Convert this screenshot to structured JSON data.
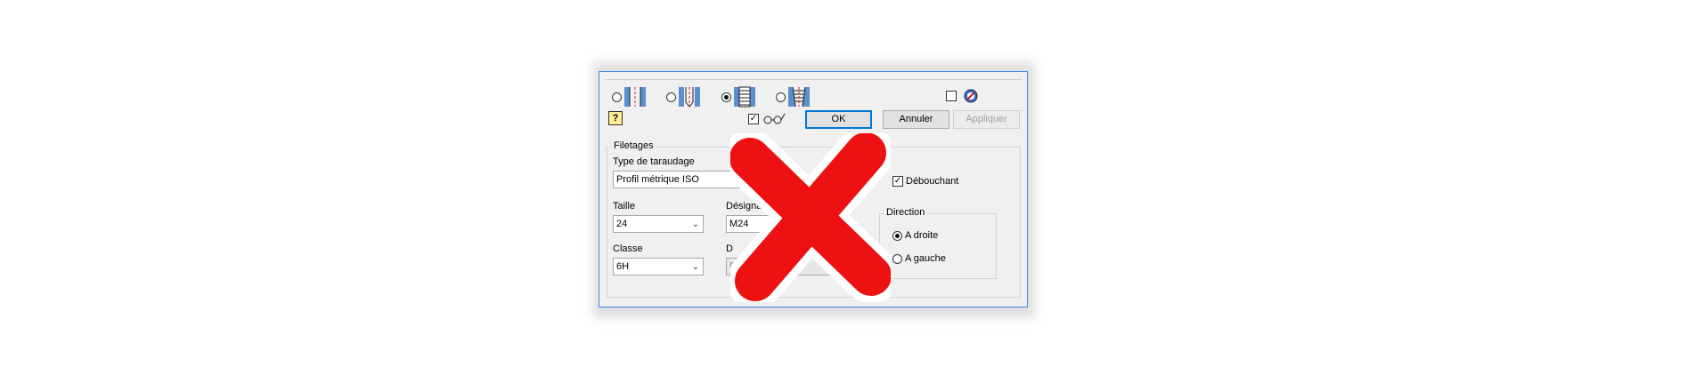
{
  "toolbar": {
    "hole_types": [
      {
        "icon": "simple-hole-icon",
        "selected": false
      },
      {
        "icon": "clearance-hole-icon",
        "selected": false
      },
      {
        "icon": "tapped-hole-icon",
        "selected": true
      },
      {
        "icon": "taper-tapped-hole-icon",
        "selected": false
      }
    ],
    "ok_label": "OK",
    "cancel_label": "Annuler",
    "apply_label": "Appliquer"
  },
  "threads": {
    "group_label": "Filetages",
    "tap_type_label": "Type de taraudage",
    "tap_type_value": "Profil métrique ISO",
    "through_label": "Débouchant",
    "through_checked": true,
    "size_label": "Taille",
    "size_value": "24",
    "designation_label": "Désignation",
    "designation_value": "M24",
    "class_label": "Classe",
    "class_value": "6H",
    "diameter_label": "D",
    "diameter_value": "P",
    "direction_label": "Direction",
    "right_label": "A droite",
    "left_label": "A gauche",
    "direction_value": "A droite"
  },
  "overlay": {
    "icon": "red-x-icon",
    "color": "#ee1111"
  }
}
